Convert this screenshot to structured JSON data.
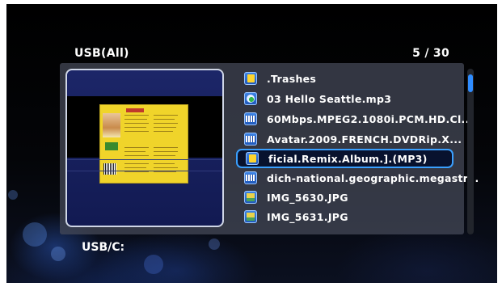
{
  "header": {
    "title": "USB(All)",
    "count": "5 / 30"
  },
  "preview": {
    "thumbnail_icon": "album-cover-thumbnail"
  },
  "files": [
    {
      "name": ".Trashes",
      "icon": "folder-icon",
      "selected": false
    },
    {
      "name": "03 Hello Seattle.mp3",
      "icon": "music-icon",
      "selected": false
    },
    {
      "name": "60Mbps.MPEG2.1080i.PCM.HD.Cl...",
      "icon": "video-icon",
      "selected": false
    },
    {
      "name": "Avatar.2009.FRENCH.DVDRip.X...",
      "icon": "video-icon",
      "selected": false
    },
    {
      "name": "ficial.Remix.Album.].(MP3)",
      "icon": "folder-icon",
      "selected": true
    },
    {
      "name": "dich-national.geographic.megastr...",
      "icon": "video-icon",
      "selected": false
    },
    {
      "name": "IMG_5630.JPG",
      "icon": "photo-icon",
      "selected": false
    },
    {
      "name": "IMG_5631.JPG",
      "icon": "photo-icon",
      "selected": false
    }
  ],
  "footer": {
    "path": "USB/C:"
  },
  "colors": {
    "selection_border": "#3aa0ff",
    "scroll_thumb": "#2f8cff",
    "icon_blue": "#2a6ad0"
  }
}
